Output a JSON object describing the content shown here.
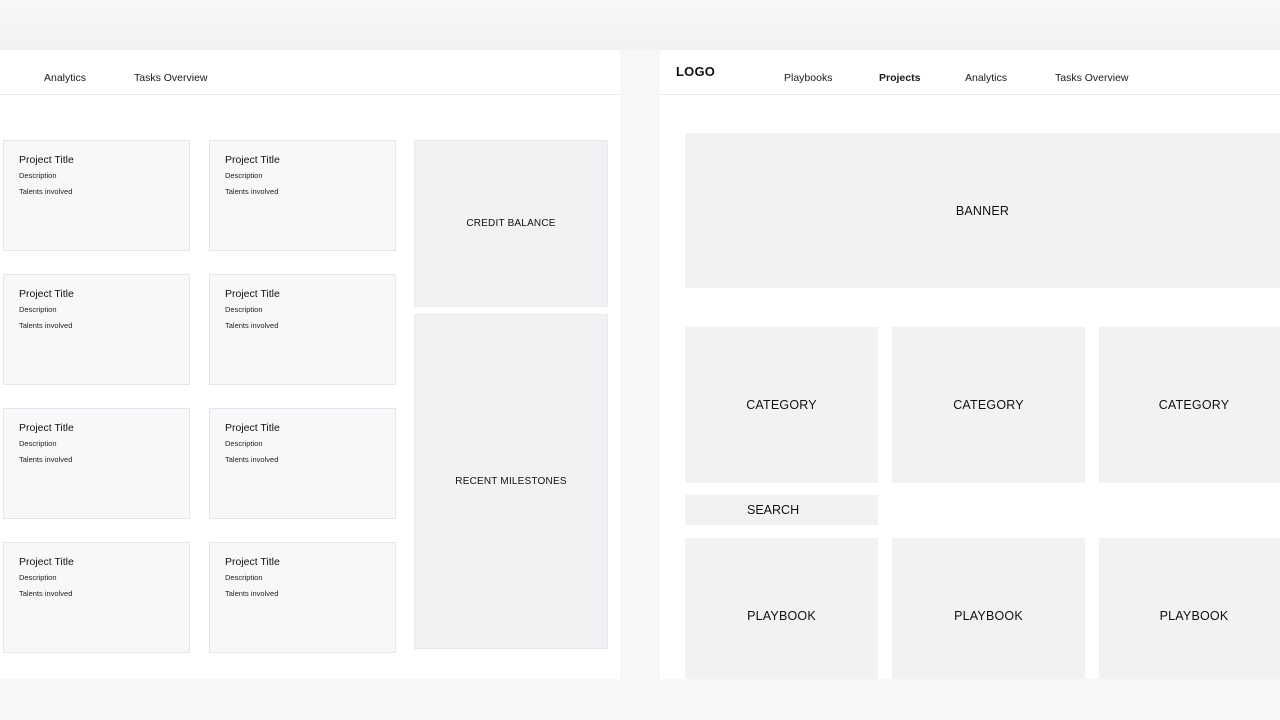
{
  "left_frame": {
    "nav": {
      "items": [
        {
          "label": "Analytics"
        },
        {
          "label": "Tasks Overview"
        }
      ]
    },
    "project_cards": [
      {
        "title": "Project Title",
        "description": "Description",
        "talents": "Talents involved"
      },
      {
        "title": "Project Title",
        "description": "Description",
        "talents": "Talents involved"
      },
      {
        "title": "Project Title",
        "description": "Description",
        "talents": "Talents involved"
      },
      {
        "title": "Project Title",
        "description": "Description",
        "talents": "Talents involved"
      },
      {
        "title": "Project Title",
        "description": "Description",
        "talents": "Talents involved"
      },
      {
        "title": "Project Title",
        "description": "Description",
        "talents": "Talents involved"
      },
      {
        "title": "Project Title",
        "description": "Description",
        "talents": "Talents involved"
      },
      {
        "title": "Project Title",
        "description": "Description",
        "talents": "Talents involved"
      }
    ],
    "credit_balance": "CREDIT BALANCE",
    "recent_milestones": "RECENT MILESTONES"
  },
  "right_frame": {
    "logo": "LOGO",
    "nav": {
      "items": [
        {
          "label": "Playbooks",
          "active": false
        },
        {
          "label": "Projects",
          "active": true
        },
        {
          "label": "Analytics",
          "active": false
        },
        {
          "label": "Tasks Overview",
          "active": false
        }
      ]
    },
    "banner": "BANNER",
    "categories": [
      "CATEGORY",
      "CATEGORY",
      "CATEGORY"
    ],
    "search": "SEARCH",
    "playbooks": [
      "PLAYBOOK",
      "PLAYBOOK",
      "PLAYBOOK"
    ]
  },
  "colors": {
    "page_background": "#f6f7f8",
    "frame_background": "#ffffff",
    "card_background": "#f7f8fa",
    "placeholder_block": "#f1f2f4",
    "border": "#e4e6e9"
  }
}
